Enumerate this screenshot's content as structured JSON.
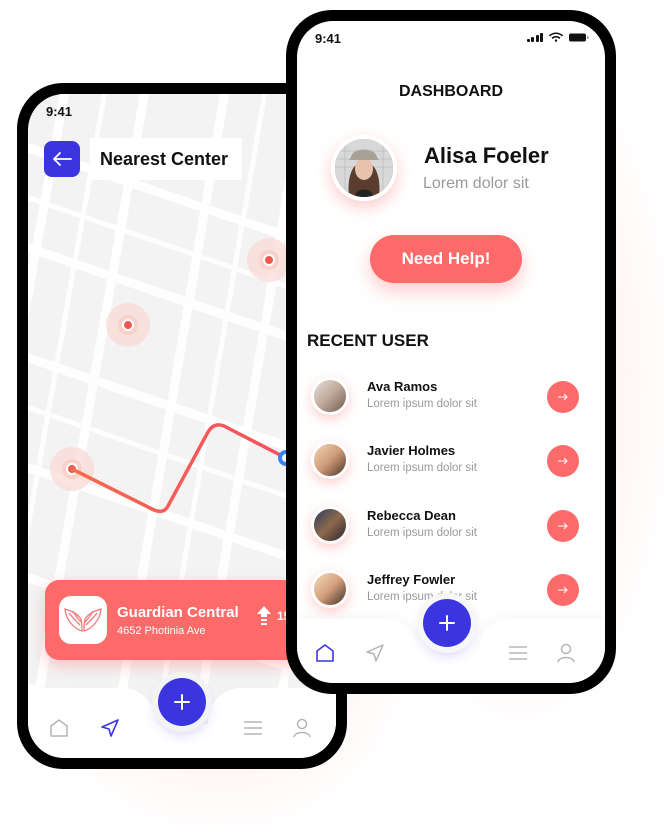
{
  "left_phone": {
    "status_time": "9:41",
    "header": {
      "title": "Nearest Center",
      "back_icon": "arrow-left-icon"
    },
    "map": {
      "markers": [
        "location-marker-1",
        "location-marker-2",
        "location-marker-3"
      ],
      "route_color": "#fc6a6a",
      "current_position_color": "#3b82f6"
    },
    "center_card": {
      "name": "Guardian Central",
      "address": "4652 Photinia Ave",
      "distance": "15",
      "logo_icon": "wings-icon",
      "direction_icon": "arrow-up-icon"
    },
    "bottom_nav": {
      "items": [
        "home-icon",
        "send-icon",
        "plus-icon",
        "menu-icon",
        "user-icon"
      ],
      "active": "send"
    }
  },
  "right_phone": {
    "status_time": "9:41",
    "title": "DASHBOARD",
    "profile": {
      "name": "Alisa Foeler",
      "subtitle": "Lorem dolor sit"
    },
    "help_button": "Need Help!",
    "recent_title": "RECENT USER",
    "users": [
      {
        "name": "Ava Ramos",
        "subtitle": "Lorem ipsum dolor sit"
      },
      {
        "name": "Javier Holmes",
        "subtitle": "Lorem ipsum dolor sit"
      },
      {
        "name": "Rebecca Dean",
        "subtitle": "Lorem ipsum dolor sit"
      },
      {
        "name": "Jeffrey Fowler",
        "subtitle": "Lorem ipsum dolor sit"
      }
    ],
    "bottom_nav": {
      "items": [
        "home-icon",
        "send-icon",
        "plus-icon",
        "menu-icon",
        "user-icon"
      ],
      "active": "home"
    }
  },
  "colors": {
    "accent_blue": "#3b35e0",
    "accent_coral": "#fc6a6a",
    "text_dark": "#111111",
    "text_muted": "#9a9a9a"
  }
}
